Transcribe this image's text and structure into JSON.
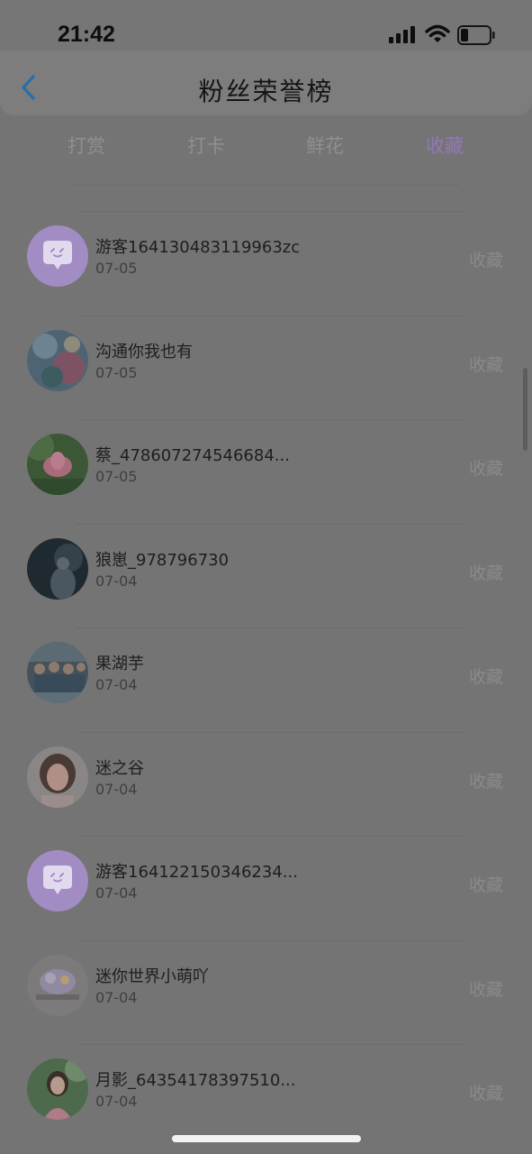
{
  "status_bar": {
    "time": "21:42"
  },
  "header": {
    "title": "粉丝荣誉榜"
  },
  "tabs": [
    {
      "label": "打赏",
      "active": false
    },
    {
      "label": "打卡",
      "active": false
    },
    {
      "label": "鲜花",
      "active": false
    },
    {
      "label": "收藏",
      "active": true
    }
  ],
  "colors": {
    "active_tab": "#9477b6",
    "guest_avatar": "#a28cc4"
  },
  "list": [
    {
      "name": "游客164130483119963zc",
      "date": "07-05",
      "tag": "收藏",
      "avatar": "guest-chat-icon"
    },
    {
      "name": "沟通你我也有",
      "date": "07-05",
      "tag": "收藏",
      "avatar": "photo"
    },
    {
      "name": "蔡_478607274546684...",
      "date": "07-05",
      "tag": "收藏",
      "avatar": "photo"
    },
    {
      "name": "狼崽_978796730",
      "date": "07-04",
      "tag": "收藏",
      "avatar": "photo"
    },
    {
      "name": "果湖芋",
      "date": "07-04",
      "tag": "收藏",
      "avatar": "photo"
    },
    {
      "name": "迷之谷",
      "date": "07-04",
      "tag": "收藏",
      "avatar": "photo"
    },
    {
      "name": "游客164122150346234...",
      "date": "07-04",
      "tag": "收藏",
      "avatar": "guest-chat-icon"
    },
    {
      "name": "迷你世界小萌吖",
      "date": "07-04",
      "tag": "收藏",
      "avatar": "photo"
    },
    {
      "name": "月影_64354178397510...",
      "date": "07-04",
      "tag": "收藏",
      "avatar": "photo"
    }
  ]
}
